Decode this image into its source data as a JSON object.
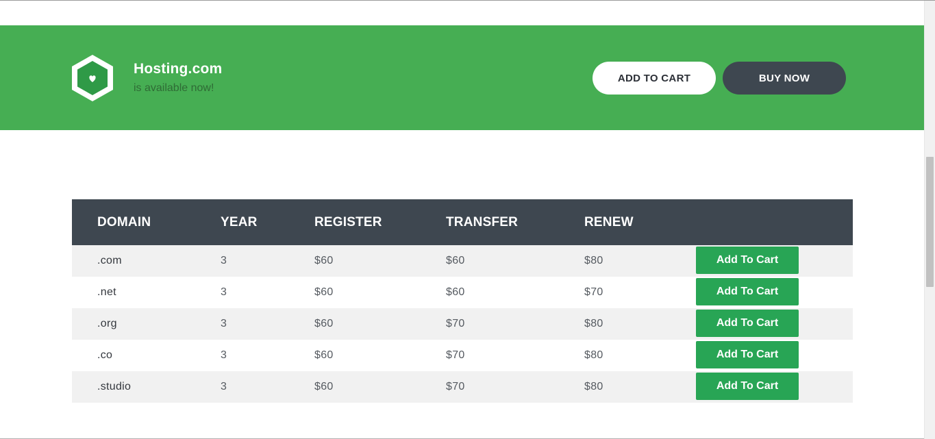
{
  "banner": {
    "title": "Hosting.com",
    "subtitle": "is available now!",
    "add_to_cart_label": "ADD TO CART",
    "buy_now_label": "BUY NOW",
    "logo_icon": "hexagon-heart-icon",
    "background_color": "#46ae53"
  },
  "table": {
    "headers": [
      "DOMAIN",
      "YEAR",
      "REGISTER",
      "TRANSFER",
      "RENEW"
    ],
    "rows": [
      {
        "domain": ".com",
        "year": "3",
        "register": "$60",
        "transfer": "$60",
        "renew": "$80",
        "button": "Add To Cart"
      },
      {
        "domain": ".net",
        "year": "3",
        "register": "$60",
        "transfer": "$60",
        "renew": "$70",
        "button": "Add To Cart"
      },
      {
        "domain": ".org",
        "year": "3",
        "register": "$60",
        "transfer": "$70",
        "renew": "$80",
        "button": "Add To Cart"
      },
      {
        "domain": ".co",
        "year": "3",
        "register": "$60",
        "transfer": "$70",
        "renew": "$80",
        "button": "Add To Cart"
      },
      {
        "domain": ".studio",
        "year": "3",
        "register": "$60",
        "transfer": "$70",
        "renew": "$80",
        "button": "Add To Cart"
      }
    ],
    "header_color": "#3e4750",
    "button_color": "#28a555"
  }
}
